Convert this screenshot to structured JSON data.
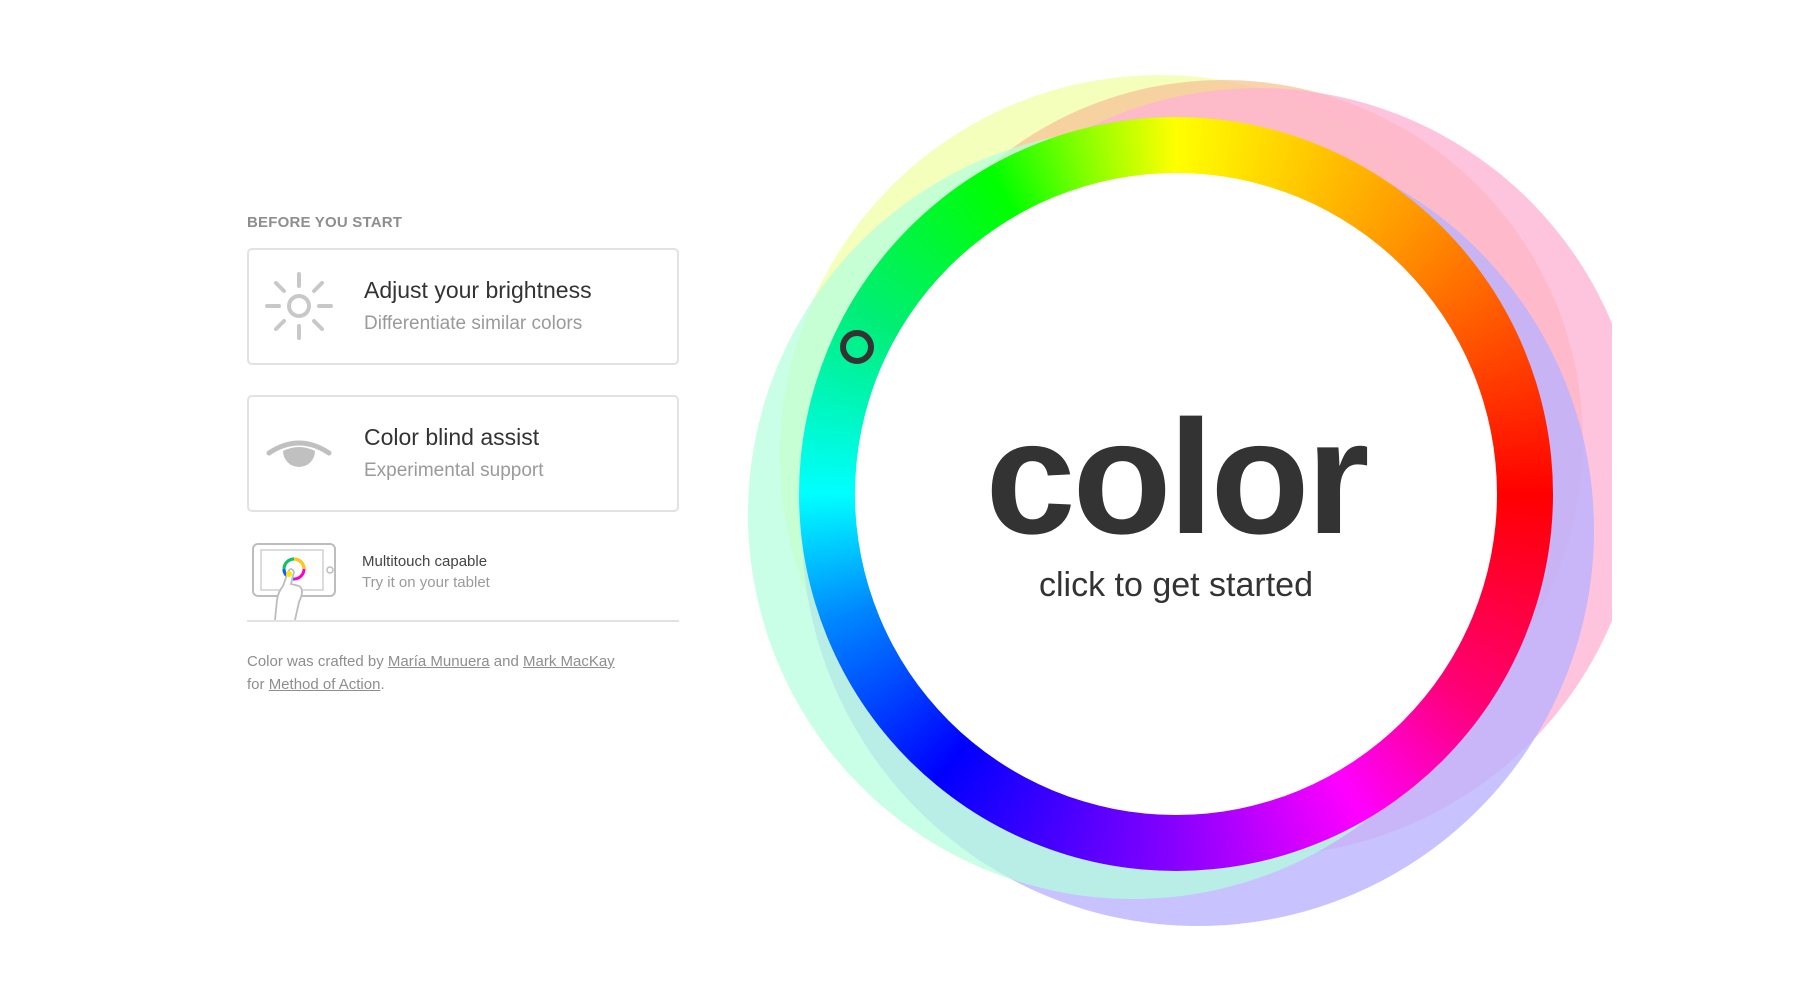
{
  "before_you_start": {
    "heading": "BEFORE YOU START",
    "brightness": {
      "title": "Adjust your brightness",
      "subtitle": "Differentiate similar colors",
      "icon": "sun-icon"
    },
    "color_blind": {
      "title": "Color blind assist",
      "subtitle": "Experimental support",
      "icon": "eye-icon"
    },
    "multitouch": {
      "title": "Multitouch capable",
      "subtitle": "Try it on your tablet",
      "icon": "tablet-touch-icon"
    }
  },
  "credits": {
    "prefix": "Color was crafted by",
    "author1": "María Munuera",
    "and": "and",
    "author2": "Mark MacKay",
    "for": "for",
    "studio": "Method of Action",
    "suffix": "."
  },
  "wheel": {
    "title": "color",
    "subtitle": "click to get started",
    "ring_colors": [
      "#ffff00",
      "#ff9900",
      "#ff0000",
      "#ff00ff",
      "#0000ff",
      "#00ffff",
      "#00ff00"
    ],
    "halo_colors": [
      "#f2ffb0",
      "#f8c79a",
      "#ffb3d4",
      "#b8b2ff",
      "#b3ffdd"
    ]
  },
  "theme": {
    "text_dark": "#333333",
    "text_muted": "#9a9a9a",
    "border": "#e2e2e2"
  }
}
